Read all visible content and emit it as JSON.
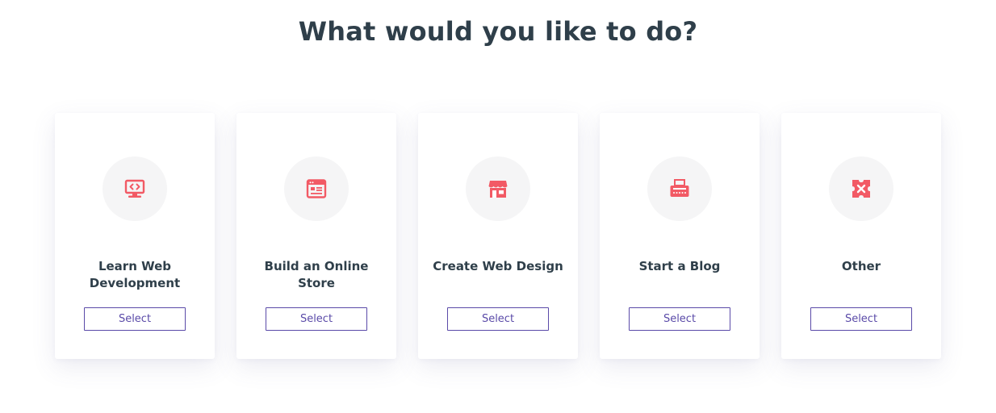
{
  "heading": "What would you like to do?",
  "colors": {
    "accent": "#f25a65",
    "button": "#5a4aa8",
    "title": "#2f3f4a",
    "icon_bg": "#f5f5f6"
  },
  "cards": [
    {
      "title": "Learn Web Development",
      "icon": "monitor-code-icon",
      "button_label": "Select"
    },
    {
      "title": "Build an Online Store",
      "icon": "browser-window-icon",
      "button_label": "Select"
    },
    {
      "title": "Create Web Design",
      "icon": "storefront-icon",
      "button_label": "Select"
    },
    {
      "title": "Start a Blog",
      "icon": "typewriter-icon",
      "button_label": "Select"
    },
    {
      "title": "Other",
      "icon": "puzzle-icon",
      "button_label": "Select"
    }
  ]
}
